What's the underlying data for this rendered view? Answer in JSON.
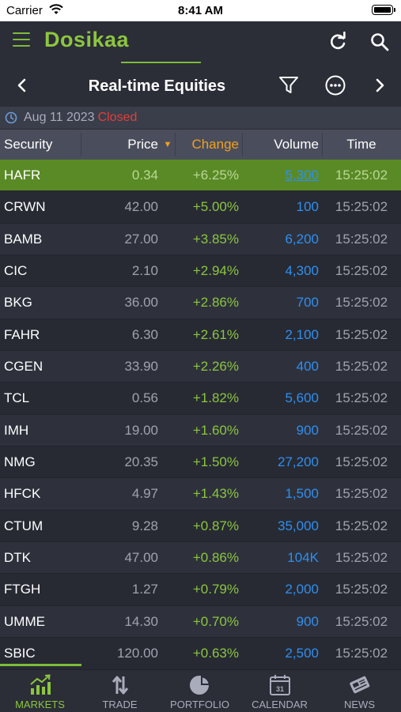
{
  "status_bar": {
    "carrier": "Carrier",
    "time": "8:41 AM"
  },
  "app_header": {
    "brand": "Dosikaa"
  },
  "title_bar": {
    "title": "Real-time Equities"
  },
  "date_row": {
    "date": "Aug 11 2023",
    "status": "Closed"
  },
  "columns": {
    "security": "Security",
    "price": "Price",
    "sort_arrow": "▼",
    "change": "Change",
    "volume": "Volume",
    "time": "Time"
  },
  "rows": [
    {
      "security": "HAFR",
      "price": "0.34",
      "change": "+6.25%",
      "volume": "5,300",
      "time": "15:25:02"
    },
    {
      "security": "CRWN",
      "price": "42.00",
      "change": "+5.00%",
      "volume": "100",
      "time": "15:25:02"
    },
    {
      "security": "BAMB",
      "price": "27.00",
      "change": "+3.85%",
      "volume": "6,200",
      "time": "15:25:02"
    },
    {
      "security": "CIC",
      "price": "2.10",
      "change": "+2.94%",
      "volume": "4,300",
      "time": "15:25:02"
    },
    {
      "security": "BKG",
      "price": "36.00",
      "change": "+2.86%",
      "volume": "700",
      "time": "15:25:02"
    },
    {
      "security": "FAHR",
      "price": "6.30",
      "change": "+2.61%",
      "volume": "2,100",
      "time": "15:25:02"
    },
    {
      "security": "CGEN",
      "price": "33.90",
      "change": "+2.26%",
      "volume": "400",
      "time": "15:25:02"
    },
    {
      "security": "TCL",
      "price": "0.56",
      "change": "+1.82%",
      "volume": "5,600",
      "time": "15:25:02"
    },
    {
      "security": "IMH",
      "price": "19.00",
      "change": "+1.60%",
      "volume": "900",
      "time": "15:25:02"
    },
    {
      "security": "NMG",
      "price": "20.35",
      "change": "+1.50%",
      "volume": "27,200",
      "time": "15:25:02"
    },
    {
      "security": "HFCK",
      "price": "4.97",
      "change": "+1.43%",
      "volume": "1,500",
      "time": "15:25:02"
    },
    {
      "security": "CTUM",
      "price": "9.28",
      "change": "+0.87%",
      "volume": "35,000",
      "time": "15:25:02"
    },
    {
      "security": "DTK",
      "price": "47.00",
      "change": "+0.86%",
      "volume": "104K",
      "time": "15:25:02"
    },
    {
      "security": "FTGH",
      "price": "1.27",
      "change": "+0.79%",
      "volume": "2,000",
      "time": "15:25:02"
    },
    {
      "security": "UMME",
      "price": "14.30",
      "change": "+0.70%",
      "volume": "900",
      "time": "15:25:02"
    },
    {
      "security": "SBIC",
      "price": "120.00",
      "change": "+0.63%",
      "volume": "2,500",
      "time": "15:25:02"
    }
  ],
  "tabs": [
    {
      "label": "MARKETS",
      "icon": "markets-chart-icon",
      "active": true
    },
    {
      "label": "TRADE",
      "icon": "trade-arrows-icon",
      "active": false
    },
    {
      "label": "PORTFOLIO",
      "icon": "portfolio-pie-icon",
      "active": false
    },
    {
      "label": "CALENDAR",
      "icon": "calendar-icon",
      "active": false
    },
    {
      "label": "NEWS",
      "icon": "news-icon",
      "active": false
    }
  ],
  "calendar_icon_day": "31",
  "colors": {
    "accent_green": "#8cc63f",
    "change_orange": "#f0a020",
    "closed_red": "#e0403a",
    "volume_blue": "#2f8ff0",
    "selected_row": "#5a8a26"
  }
}
